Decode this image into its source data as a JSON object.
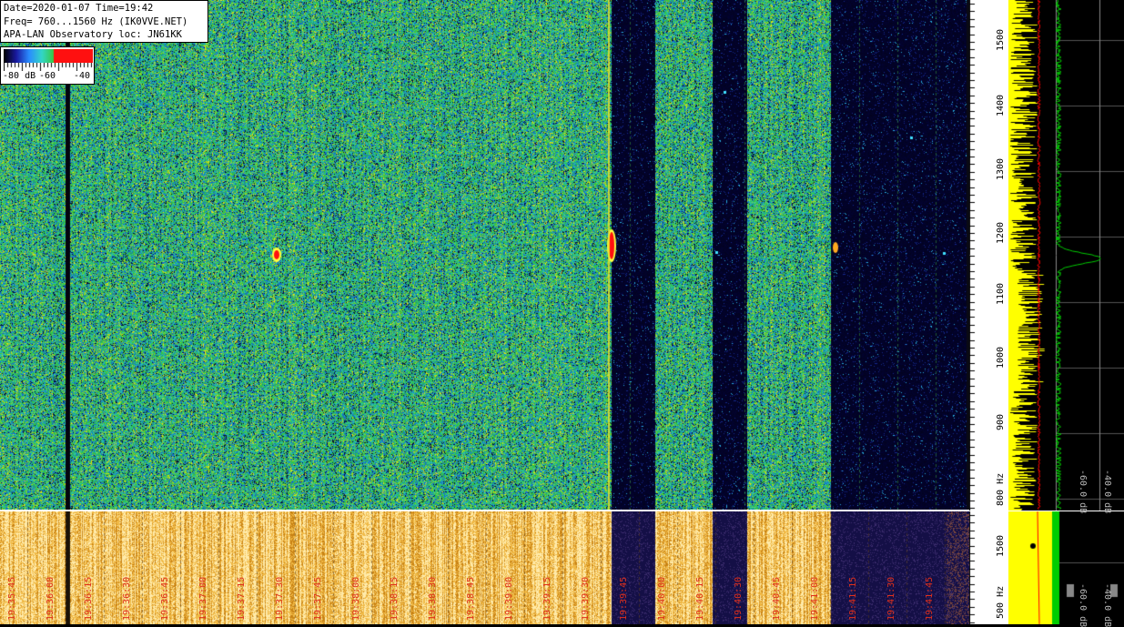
{
  "header": {
    "date_time": "Date=2020-01-07 Time=19:42",
    "freq": "Freq= 760...1560 Hz (IK0VVE.NET)",
    "observatory": "APA-LAN Observatory loc: JN61KK"
  },
  "color_scale": {
    "labels": [
      "-80 dB",
      "-60",
      "-40"
    ],
    "colors": [
      "#000000",
      "#1a1aa0",
      "#2a8cff",
      "#33d6c8",
      "#38c838",
      "#f0f000",
      "#ffa000",
      "#ff1010"
    ]
  },
  "frequency_axis": {
    "labels": [
      "1500",
      "1400",
      "1300",
      "1200",
      "1100",
      "1000",
      "900",
      "800 Hz"
    ]
  },
  "frequency_axis_low": {
    "labels": [
      "1500",
      "500 Hz"
    ]
  },
  "spectrum_panel": {
    "db_labels": [
      "-60.0 dB",
      "-40.0 dB"
    ],
    "db_labels_low": [
      "-60.0 dB",
      "-40.0 dB"
    ],
    "trace_colors": [
      "#ffff00",
      "#00cc00",
      "#ff0000"
    ]
  },
  "time_axis": {
    "labels": [
      "19:35:45",
      "19:36:00",
      "19:36:15",
      "19:36:30",
      "19:36:45",
      "19:37:00",
      "19:37:15",
      "19:37:30",
      "19:37:45",
      "19:38:00",
      "19:38:15",
      "19:38:30",
      "19:38:45",
      "19:39:00",
      "19:39:15",
      "19:39:30",
      "19:39:45",
      "19:40:00",
      "19:40:15",
      "19:40:30",
      "19:40:45",
      "19:41:00",
      "19:41:15",
      "19:41:30",
      "19:41:45"
    ]
  }
}
